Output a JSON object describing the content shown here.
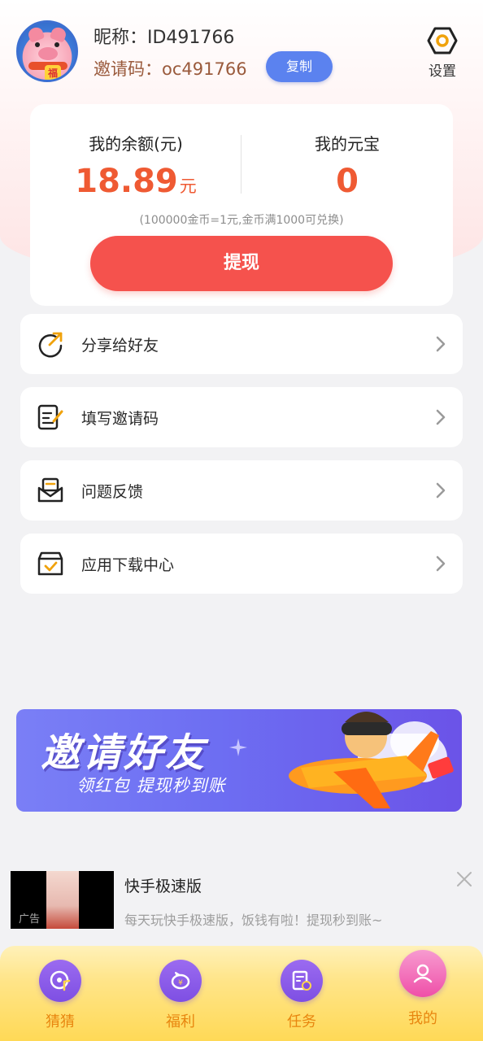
{
  "profile": {
    "nickname": "昵称：ID491766",
    "invite_code": "邀请码：oc491766",
    "copy_label": "复制",
    "settings_label": "设置"
  },
  "balance": {
    "left_title": "我的余额(元)",
    "left_value": "18.89",
    "left_unit": "元",
    "right_title": "我的元宝",
    "right_value": "0",
    "note": "(100000金币=1元,金币满1000可兑换)",
    "withdraw_label": "提现"
  },
  "menu": [
    {
      "label": "分享给好友",
      "icon": "share-icon"
    },
    {
      "label": "填写邀请码",
      "icon": "edit-form-icon"
    },
    {
      "label": "问题反馈",
      "icon": "feedback-mail-icon"
    },
    {
      "label": "应用下载中心",
      "icon": "download-box-icon"
    }
  ],
  "banner": {
    "title": "邀请好友",
    "subtitle": "领红包 提现秒到账"
  },
  "ad": {
    "tag": "广告",
    "title": "快手极速版",
    "desc": "每天玩快手极速版，饭钱有啦！提现秒到账~"
  },
  "tabs": [
    {
      "label": "猜猜",
      "icon": "music-disc-icon"
    },
    {
      "label": "福利",
      "icon": "piggy-bank-icon"
    },
    {
      "label": "任务",
      "icon": "task-clock-icon"
    },
    {
      "label": "我的",
      "icon": "user-icon"
    }
  ],
  "colors": {
    "accent_red": "#f5524d",
    "value_orange": "#ef5a33",
    "copy_blue": "#5b82ef",
    "tab_purple": "#7e4fe3",
    "tab_active_pink": "#ef4fa8",
    "tab_label_orange": "#e8860f"
  }
}
